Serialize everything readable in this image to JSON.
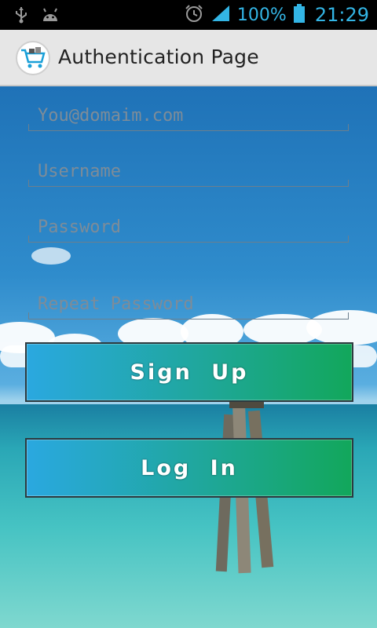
{
  "status_bar": {
    "battery_percent": "100%",
    "time": "21:29",
    "icons": [
      "usb-icon",
      "android-debug-icon",
      "alarm-icon",
      "signal-icon",
      "battery-icon"
    ]
  },
  "action_bar": {
    "title": "Authentication Page",
    "app_icon": "shopping-cart-icon"
  },
  "form": {
    "email_placeholder": "You@domaim.com",
    "username_placeholder": "Username",
    "password_placeholder": "Password",
    "repeat_password_placeholder": "Repeat Password"
  },
  "buttons": {
    "signup_label": "Sign Up",
    "login_label": "Log In"
  }
}
